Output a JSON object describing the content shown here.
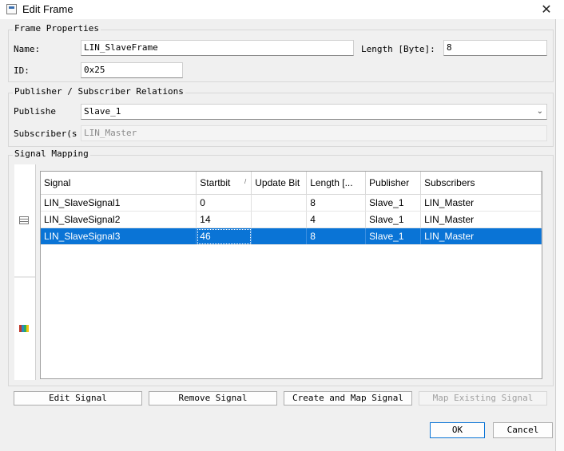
{
  "window": {
    "title": "Edit Frame",
    "close_glyph": "✕"
  },
  "frame_properties": {
    "legend": "Frame Properties",
    "name_label": "Name:",
    "name_value": "LIN_SlaveFrame",
    "length_label": "Length [Byte]:",
    "length_value": "8",
    "id_label": "ID:",
    "id_value": "0x25"
  },
  "relations": {
    "legend": "Publisher / Subscriber Relations",
    "publisher_label": "Publishe",
    "publisher_value": "Slave_1",
    "subscriber_label": "Subscriber(s",
    "subscriber_value": "LIN_Master"
  },
  "signal_mapping": {
    "legend": "Signal Mapping",
    "sidebar_icons": [
      "properties-icon",
      "categorized-icon"
    ],
    "columns": [
      "Signal",
      "Startbit",
      "Update Bit",
      "Length [...",
      "Publisher",
      "Subscribers"
    ],
    "sort_glyph": "/",
    "rows": [
      [
        "LIN_SlaveSignal1",
        "0",
        "",
        "8",
        "Slave_1",
        "LIN_Master"
      ],
      [
        "LIN_SlaveSignal2",
        "14",
        "",
        "4",
        "Slave_1",
        "LIN_Master"
      ],
      [
        "LIN_SlaveSignal3",
        "46",
        "",
        "8",
        "Slave_1",
        "LIN_Master"
      ]
    ],
    "selected_row": 2,
    "selection_color": "#0a74d6"
  },
  "buttons": {
    "edit_signal": "Edit Signal",
    "remove_signal": "Remove Signal",
    "create_map_signal": "Create and Map Signal",
    "map_existing_signal": "Map Existing Signal",
    "ok": "OK",
    "cancel": "Cancel"
  }
}
